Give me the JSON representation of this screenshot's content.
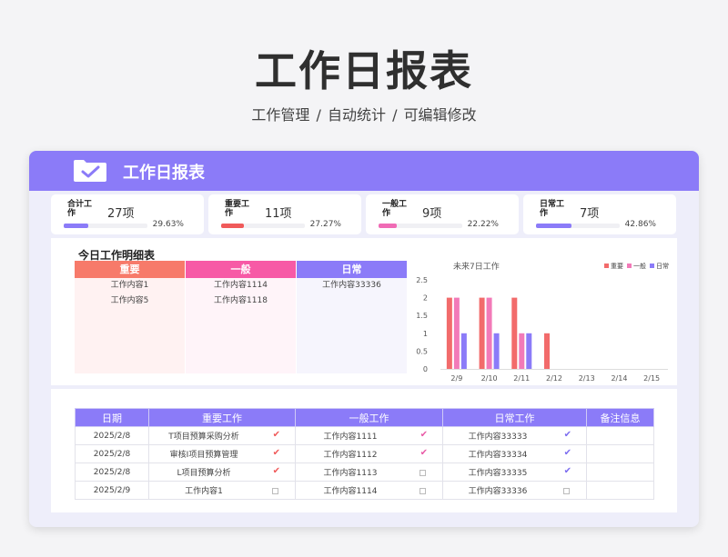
{
  "hero": {
    "title": "工作日报表",
    "subtitle": "工作管理 /  自动统计  /  可编辑修改"
  },
  "card": {
    "title": "工作日报表"
  },
  "stats": [
    {
      "label": "合计工作",
      "count": "27项",
      "percent": "29.63%",
      "fill": 0.2963,
      "color": "#8b7bf8"
    },
    {
      "label": "重要工作",
      "count": "11项",
      "percent": "27.27%",
      "fill": 0.2727,
      "color": "#f05a5a"
    },
    {
      "label": "一般工作",
      "count": "9项",
      "percent": "22.22%",
      "fill": 0.2222,
      "color": "#f06bb5"
    },
    {
      "label": "日常工作",
      "count": "7项",
      "percent": "42.86%",
      "fill": 0.4286,
      "color": "#8b7bf8"
    }
  ],
  "detail": {
    "title": "今日工作明细表",
    "columns": [
      {
        "header": "重要",
        "color": "#f77a6a",
        "bg": "#fff2f2",
        "items": [
          "工作内容1",
          "工作内容5"
        ]
      },
      {
        "header": "一般",
        "color": "#f75aa6",
        "bg": "#fff4f9",
        "items": [
          "工作内容1114",
          "工作内容1118"
        ]
      },
      {
        "header": "日常",
        "color": "#8b7bf8",
        "bg": "#f6f5fd",
        "items": [
          "工作内容33336"
        ]
      }
    ]
  },
  "chart_data": {
    "type": "bar",
    "title": "未来7日工作",
    "categories": [
      "2/9",
      "2/10",
      "2/11",
      "2/12",
      "2/13",
      "2/14",
      "2/15"
    ],
    "series": [
      {
        "name": "重要",
        "color": "#f26b6b",
        "values": [
          2,
          2,
          2,
          1,
          0,
          0,
          0
        ]
      },
      {
        "name": "一般",
        "color": "#f27ab8",
        "values": [
          2,
          2,
          1,
          0,
          0,
          0,
          0
        ]
      },
      {
        "name": "日常",
        "color": "#8b7bf8",
        "values": [
          1,
          1,
          1,
          0,
          0,
          0,
          0
        ]
      }
    ],
    "ylim": [
      0,
      2.5
    ],
    "yticks": [
      "0",
      "0.5",
      "1",
      "1.5",
      "2",
      "2.5"
    ],
    "legend": "top-right",
    "grid": false
  },
  "log": {
    "headers": [
      "日期",
      "重要工作",
      "一般工作",
      "日常工作",
      "备注信息"
    ],
    "rows": [
      {
        "date": "2025/2/8",
        "important": "T项目预算采购分析",
        "important_done": true,
        "general": "工作内容1111",
        "general_done": true,
        "daily": "工作内容33333",
        "daily_done": true,
        "note": ""
      },
      {
        "date": "2025/2/8",
        "important": "审核I项目预算管理",
        "important_done": true,
        "general": "工作内容1112",
        "general_done": true,
        "daily": "工作内容33334",
        "daily_done": true,
        "note": ""
      },
      {
        "date": "2025/2/8",
        "important": "L项目预算分析",
        "important_done": true,
        "general": "工作内容1113",
        "general_done": false,
        "daily": "工作内容33335",
        "daily_done": true,
        "note": ""
      },
      {
        "date": "2025/2/9",
        "important": "工作内容1",
        "important_done": false,
        "general": "工作内容1114",
        "general_done": false,
        "daily": "工作内容33336",
        "daily_done": false,
        "note": ""
      }
    ],
    "check_colors": {
      "important": "#f05a5a",
      "general": "#e85aa6",
      "daily": "#7b6cf0"
    }
  }
}
